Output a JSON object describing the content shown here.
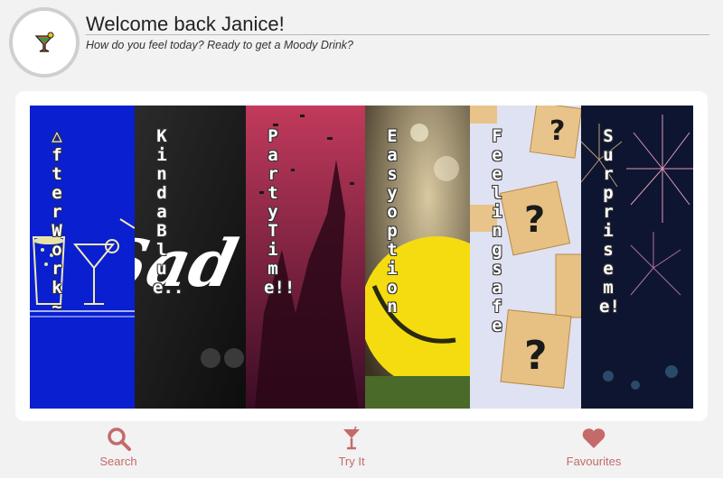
{
  "header": {
    "title": "Welcome back Janice!",
    "subtitle": "How do you feel today? Ready to get a Moody Drink?",
    "avatar_icon": "cocktail-icon"
  },
  "moods": [
    {
      "label": "△fter Work~",
      "color": "#0a1fd0"
    },
    {
      "label": "Kinda Blue..",
      "color": "#151515"
    },
    {
      "label": "Party Time!!",
      "color": "#8d1e3e"
    },
    {
      "label": "Easy option",
      "color": "#f3d414"
    },
    {
      "label": "Feeling safe",
      "color": "#d9ddf0"
    },
    {
      "label": "Surprise me!",
      "color": "#0e1530"
    }
  ],
  "card_graphics": {
    "sad_word": "Sad"
  },
  "nav": {
    "items": [
      {
        "label": "Search",
        "icon": "search-icon"
      },
      {
        "label": "Try It",
        "icon": "cocktail-glass-icon"
      },
      {
        "label": "Favourites",
        "icon": "heart-icon"
      }
    ],
    "color": "#c46a6a"
  }
}
